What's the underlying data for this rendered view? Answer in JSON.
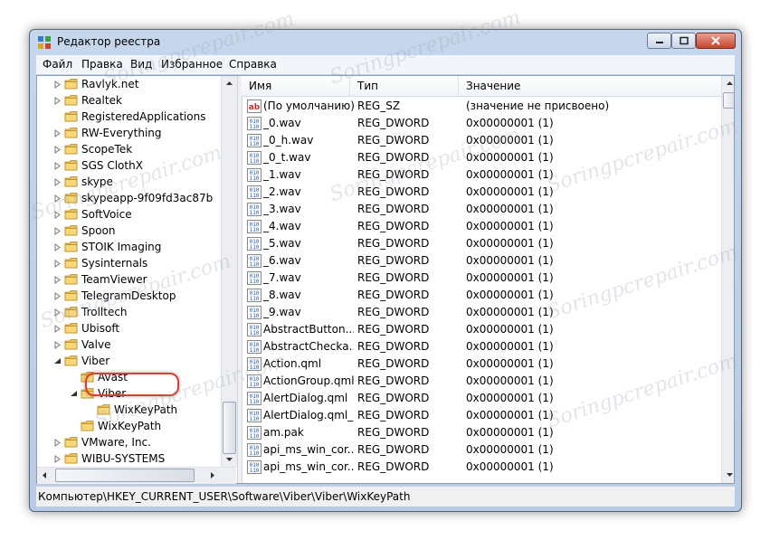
{
  "window": {
    "title": "Редактор реестра"
  },
  "menu": [
    "Файл",
    "Правка",
    "Вид",
    "Избранное",
    "Справка"
  ],
  "tree": [
    {
      "label": "Ravlyk.net",
      "level": 0,
      "expander": "collapsed"
    },
    {
      "label": "Realtek",
      "level": 0,
      "expander": "collapsed"
    },
    {
      "label": "RegisteredApplications",
      "level": 0,
      "expander": "none"
    },
    {
      "label": "RW-Everything",
      "level": 0,
      "expander": "collapsed"
    },
    {
      "label": "ScopeTek",
      "level": 0,
      "expander": "collapsed"
    },
    {
      "label": "SGS ClothX",
      "level": 0,
      "expander": "collapsed"
    },
    {
      "label": "skype",
      "level": 0,
      "expander": "collapsed"
    },
    {
      "label": "skypeapp-9f09fd3ac87b",
      "level": 0,
      "expander": "collapsed"
    },
    {
      "label": "SoftVoice",
      "level": 0,
      "expander": "collapsed"
    },
    {
      "label": "Spoon",
      "level": 0,
      "expander": "collapsed"
    },
    {
      "label": "STOIK Imaging",
      "level": 0,
      "expander": "collapsed"
    },
    {
      "label": "Sysinternals",
      "level": 0,
      "expander": "collapsed"
    },
    {
      "label": "TeamViewer",
      "level": 0,
      "expander": "collapsed"
    },
    {
      "label": "TelegramDesktop",
      "level": 0,
      "expander": "collapsed"
    },
    {
      "label": "Trolltech",
      "level": 0,
      "expander": "collapsed"
    },
    {
      "label": "Ubisoft",
      "level": 0,
      "expander": "collapsed"
    },
    {
      "label": "Valve",
      "level": 0,
      "expander": "collapsed"
    },
    {
      "label": "Viber",
      "level": 0,
      "expander": "expanded"
    },
    {
      "label": "Avast",
      "level": 1,
      "expander": "none"
    },
    {
      "label": "Viber",
      "level": 1,
      "expander": "expanded"
    },
    {
      "label": "WixKeyPath",
      "level": 2,
      "expander": "none",
      "selected": true
    },
    {
      "label": "WixKeyPath",
      "level": 1,
      "expander": "none"
    },
    {
      "label": "VMware, Inc.",
      "level": 0,
      "expander": "collapsed"
    },
    {
      "label": "WIBU-SYSTEMS",
      "level": 0,
      "expander": "collapsed"
    }
  ],
  "columns": [
    "Имя",
    "Тип",
    "Значение"
  ],
  "values": [
    {
      "icon": "string-value-icon",
      "name": "(По умолчанию)",
      "type": "REG_SZ",
      "data": "(значение не присвоено)"
    },
    {
      "icon": "binary-value-icon",
      "name": "_0.wav",
      "type": "REG_DWORD",
      "data": "0x00000001 (1)"
    },
    {
      "icon": "binary-value-icon",
      "name": "_0_h.wav",
      "type": "REG_DWORD",
      "data": "0x00000001 (1)"
    },
    {
      "icon": "binary-value-icon",
      "name": "_0_t.wav",
      "type": "REG_DWORD",
      "data": "0x00000001 (1)"
    },
    {
      "icon": "binary-value-icon",
      "name": "_1.wav",
      "type": "REG_DWORD",
      "data": "0x00000001 (1)"
    },
    {
      "icon": "binary-value-icon",
      "name": "_2.wav",
      "type": "REG_DWORD",
      "data": "0x00000001 (1)"
    },
    {
      "icon": "binary-value-icon",
      "name": "_3.wav",
      "type": "REG_DWORD",
      "data": "0x00000001 (1)"
    },
    {
      "icon": "binary-value-icon",
      "name": "_4.wav",
      "type": "REG_DWORD",
      "data": "0x00000001 (1)"
    },
    {
      "icon": "binary-value-icon",
      "name": "_5.wav",
      "type": "REG_DWORD",
      "data": "0x00000001 (1)"
    },
    {
      "icon": "binary-value-icon",
      "name": "_6.wav",
      "type": "REG_DWORD",
      "data": "0x00000001 (1)"
    },
    {
      "icon": "binary-value-icon",
      "name": "_7.wav",
      "type": "REG_DWORD",
      "data": "0x00000001 (1)"
    },
    {
      "icon": "binary-value-icon",
      "name": "_8.wav",
      "type": "REG_DWORD",
      "data": "0x00000001 (1)"
    },
    {
      "icon": "binary-value-icon",
      "name": "_9.wav",
      "type": "REG_DWORD",
      "data": "0x00000001 (1)"
    },
    {
      "icon": "binary-value-icon",
      "name": "AbstractButton....",
      "type": "REG_DWORD",
      "data": "0x00000001 (1)"
    },
    {
      "icon": "binary-value-icon",
      "name": "AbstractCheckа...",
      "type": "REG_DWORD",
      "data": "0x00000001 (1)"
    },
    {
      "icon": "binary-value-icon",
      "name": "Action.qml",
      "type": "REG_DWORD",
      "data": "0x00000001 (1)"
    },
    {
      "icon": "binary-value-icon",
      "name": "ActionGroup.qml",
      "type": "REG_DWORD",
      "data": "0x00000001 (1)"
    },
    {
      "icon": "binary-value-icon",
      "name": "AlertDialog.qml",
      "type": "REG_DWORD",
      "data": "0x00000001 (1)"
    },
    {
      "icon": "binary-value-icon",
      "name": "AlertDialog.qml_1",
      "type": "REG_DWORD",
      "data": "0x00000001 (1)"
    },
    {
      "icon": "binary-value-icon",
      "name": "am.pak",
      "type": "REG_DWORD",
      "data": "0x00000001 (1)"
    },
    {
      "icon": "binary-value-icon",
      "name": "api_ms_win_cor...",
      "type": "REG_DWORD",
      "data": "0x00000001 (1)"
    },
    {
      "icon": "binary-value-icon",
      "name": "api_ms_win_cor...",
      "type": "REG_DWORD",
      "data": "0x00000001 (1)"
    }
  ],
  "statusbar": {
    "path": "Компьютер\\HKEY_CURRENT_USER\\Software\\Viber\\Viber\\WixKeyPath"
  },
  "watermark": "Soringpcrepair.com",
  "colors": {
    "highlight_ring": "#e23b2e",
    "folder": "#e8c25a",
    "selection": "#cce4f7"
  }
}
